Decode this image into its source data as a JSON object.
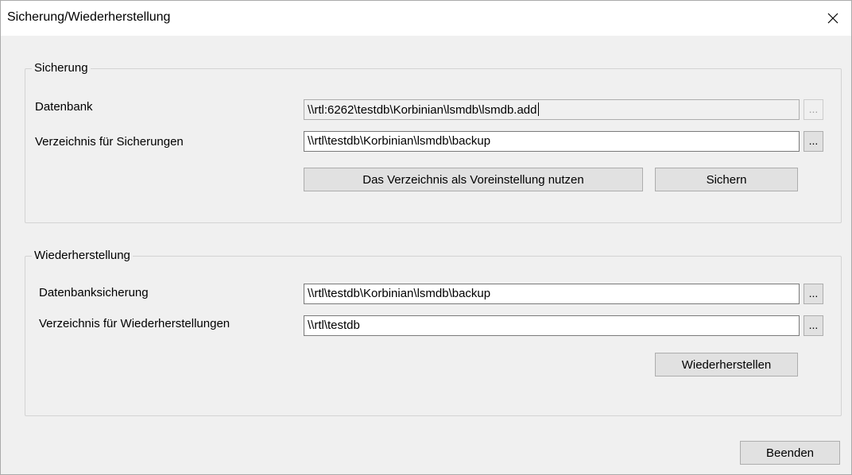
{
  "window": {
    "title": "Sicherung/Wiederherstellung",
    "close_icon": "close-icon"
  },
  "backup": {
    "legend": "Sicherung",
    "database_label": "Datenbank",
    "database_value": "\\\\rtl:6262\\testdb\\Korbinian\\lsmdb\\lsmdb.add",
    "database_browse": "...",
    "directory_label": "Verzeichnis für Sicherungen",
    "directory_value": "\\\\rtl\\testdb\\Korbinian\\lsmdb\\backup",
    "directory_browse": "...",
    "set_default_button": "Das Verzeichnis als Voreinstellung nutzen",
    "backup_button": "Sichern"
  },
  "restore": {
    "legend": "Wiederherstellung",
    "backup_label": "Datenbanksicherung",
    "backup_value": "\\\\rtl\\testdb\\Korbinian\\lsmdb\\backup",
    "backup_browse": "...",
    "target_label": "Verzeichnis für Wiederherstellungen",
    "target_value": "\\\\rtl\\testdb",
    "target_browse": "...",
    "restore_button": "Wiederherstellen"
  },
  "footer": {
    "exit_button": "Beenden"
  }
}
